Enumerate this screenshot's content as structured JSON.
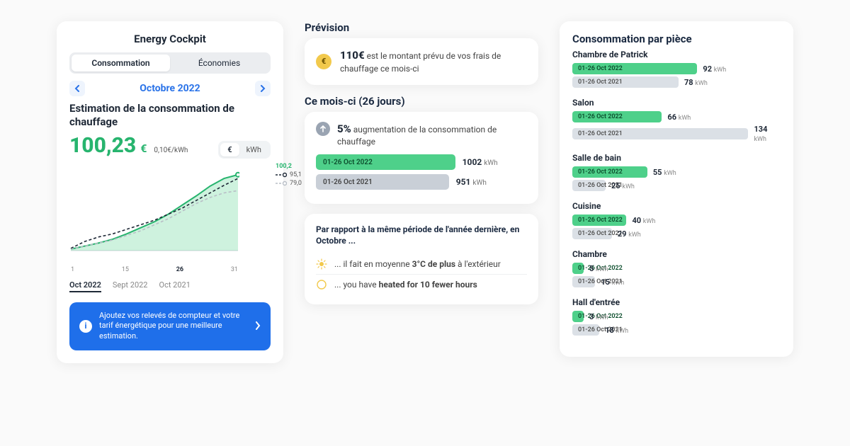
{
  "header": {
    "title": "Energy Cockpit",
    "tabs": [
      "Consommation",
      "Économies"
    ],
    "month_label": "Octobre 2022"
  },
  "estimate": {
    "heading": "Estimation de la consommation de chauffage",
    "amount": "100,23",
    "currency": "€",
    "rate": "0,10€/kWh",
    "unit_euro": "€",
    "unit_kwh": "kWh"
  },
  "chart_legend": {
    "current": "100,2",
    "prev": "95,1",
    "lastyear": "79,0"
  },
  "chart_data": {
    "type": "line",
    "x_ticks": [
      "1",
      "15",
      "26",
      "31"
    ],
    "x_highlight": "26",
    "series": [
      {
        "name": "Oct 2022",
        "style": "area-green",
        "values": [
          2,
          6,
          10,
          15,
          22,
          30,
          38,
          48,
          60,
          72,
          85,
          95,
          100
        ]
      },
      {
        "name": "Sept 2022",
        "style": "dash-dark",
        "values": [
          3,
          12,
          18,
          22,
          28,
          34,
          40,
          48,
          56,
          66,
          76,
          86,
          95
        ]
      },
      {
        "name": "Oct 2021",
        "style": "dash-light",
        "values": [
          2,
          6,
          10,
          14,
          20,
          26,
          34,
          42,
          52,
          62,
          70,
          76,
          79
        ]
      }
    ],
    "ylim": [
      0,
      110
    ]
  },
  "period_tabs": [
    "Oct 2022",
    "Sept 2022",
    "Oct 2021"
  ],
  "banner": {
    "text": "Ajoutez vos relevés de compteur et votre tarif énergétique pour une meilleure estimation."
  },
  "forecast": {
    "title": "Prévision",
    "amount": "110€",
    "text_suffix": "est le montant prévu de vos frais de chauffage ce mois-ci"
  },
  "thismonth": {
    "title": "Ce mois-ci (26 jours)",
    "increase_pct": "5%",
    "increase_text": "augmentation de la consommation de chauffage",
    "bars": [
      {
        "label": "01-26 Oct 2022",
        "value": "1002",
        "unit": "kWh",
        "pct": 66,
        "color": "green"
      },
      {
        "label": "01-26 Oct 2021",
        "value": "951",
        "unit": "kWh",
        "pct": 63,
        "color": "grey"
      }
    ]
  },
  "compare": {
    "heading": "Par rapport à la même période de l'année dernière, en Octobre ...",
    "temp_prefix": "... il fait en moyenne ",
    "temp_bold": "3°C de plus",
    "temp_suffix": " à l'extérieur",
    "hours_prefix": "... you have ",
    "hours_bold": "heated for 10 fewer hours"
  },
  "rooms": {
    "title": "Consommation par pièce",
    "period_cur": "01-26 Oct 2022",
    "period_prev": "01-26 Oct 2021",
    "unit": "kWh",
    "list": [
      {
        "name": "Chambre de Patrick",
        "cur": 92,
        "prev": 78,
        "cur_pct": 60,
        "prev_pct": 51
      },
      {
        "name": "Salon",
        "cur": 66,
        "prev": 134,
        "cur_pct": 43,
        "prev_pct": 88
      },
      {
        "name": "Salle de bain",
        "cur": 55,
        "prev": 25,
        "cur_pct": 36,
        "prev_pct": 16
      },
      {
        "name": "Cuisine",
        "cur": 40,
        "prev": 29,
        "cur_pct": 26,
        "prev_pct": 19
      },
      {
        "name": "Chambre",
        "cur": 5,
        "prev": 15,
        "cur_pct": 4,
        "prev_pct": 11
      },
      {
        "name": "Hall d'entrée",
        "cur": 3,
        "prev": 18,
        "cur_pct": 3,
        "prev_pct": 13
      }
    ]
  }
}
